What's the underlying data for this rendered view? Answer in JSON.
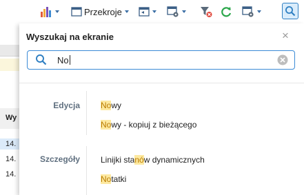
{
  "toolbar": {
    "przekroje_label": "Przekroje"
  },
  "background": {
    "header_text": "Wy",
    "row_values": [
      "14.",
      "14.",
      "14."
    ]
  },
  "panel": {
    "title": "Wyszukaj na ekranie",
    "search_value": "No"
  },
  "groups": [
    {
      "name": "Edycja",
      "results": [
        {
          "pre": "",
          "match": "No",
          "post": "wy"
        },
        {
          "pre": "",
          "match": "No",
          "post": "wy - kopiuj z bieżącego"
        }
      ]
    },
    {
      "name": "Szczegóły",
      "results": [
        {
          "pre": "Linijki sta",
          "match": "nó",
          "post": "w dynamicznych"
        },
        {
          "pre": "",
          "match": "No",
          "post": "tatki"
        }
      ]
    }
  ],
  "colors": {
    "accent": "#2f7fc2",
    "highlight_bg": "#fde9a0",
    "highlight_text": "#b97a00"
  }
}
